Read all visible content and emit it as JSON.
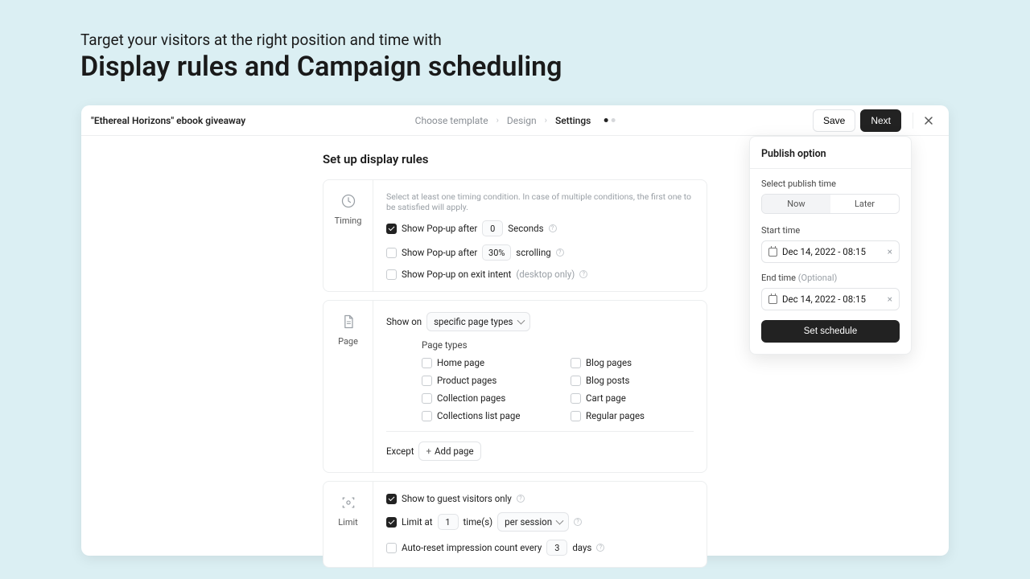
{
  "hero": {
    "sub": "Target your visitors at the right position and time with",
    "title": "Display rules and Campaign scheduling"
  },
  "topbar": {
    "campaign_title": "\"Ethereal Horizons\" ebook giveaway",
    "steps": [
      "Choose template",
      "Design",
      "Settings"
    ],
    "active_step_index": 2,
    "save_label": "Save",
    "next_label": "Next"
  },
  "section_title": "Set up display rules",
  "timing": {
    "side_label": "Timing",
    "hint": "Select at least one timing condition. In case of multiple conditions, the first one to be satisfied will apply.",
    "row_after": {
      "checked": true,
      "prefix": "Show Pop-up after",
      "value": "0",
      "unit": "Seconds"
    },
    "row_scroll": {
      "checked": false,
      "prefix": "Show Pop-up after",
      "value": "30%",
      "unit": "scrolling"
    },
    "row_exit": {
      "checked": false,
      "label": "Show Pop-up on exit intent",
      "note": "(desktop only)"
    }
  },
  "page": {
    "side_label": "Page",
    "show_on_label": "Show on",
    "show_on_value": "specific page types",
    "types_heading": "Page types",
    "types_left": [
      "Home page",
      "Product pages",
      "Collection pages",
      "Collections list page"
    ],
    "types_right": [
      "Blog pages",
      "Blog posts",
      "Cart page",
      "Regular pages"
    ],
    "except_label": "Except",
    "add_page_label": "Add page"
  },
  "limit": {
    "side_label": "Limit",
    "row_guest": {
      "checked": true,
      "label": "Show to guest visitors only"
    },
    "row_limit": {
      "checked": true,
      "prefix": "Limit at",
      "value": "1",
      "unit": "time(s)",
      "scope": "per session"
    },
    "row_reset": {
      "checked": false,
      "prefix": "Auto-reset impression count every",
      "value": "3",
      "unit": "days"
    }
  },
  "popover": {
    "title": "Publish option",
    "select_label": "Select publish time",
    "now": "Now",
    "later": "Later",
    "start_label": "Start time",
    "start_value": "Dec 14, 2022 - 08:15",
    "end_label": "End time",
    "end_optional": "(Optional)",
    "end_value": "Dec 14, 2022 - 08:15",
    "set_label": "Set schedule"
  }
}
